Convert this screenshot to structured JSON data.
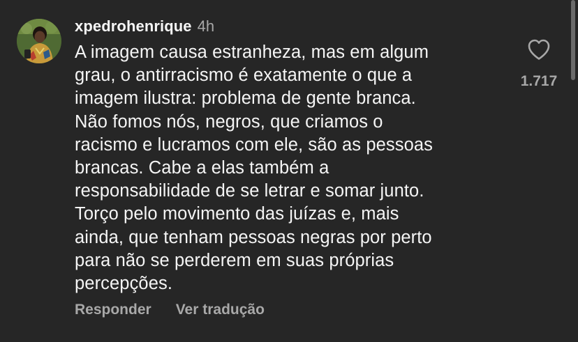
{
  "comment": {
    "username": "xpedrohenrique",
    "time": "4h",
    "text": "A imagem causa estranheza, mas em algum\ngrau, o antirracismo é exatamente o que a\nimagem ilustra: problema de gente branca.\nNão fomos nós, negros, que criamos o\nracismo e lucramos com ele, são as pessoas\nbrancas. Cabe a elas também a\nresponsabilidade de se letrar e somar junto.\nTorço pelo movimento das juízas e, mais\nainda, que tenham pessoas negras por perto\npara não se perderem em suas próprias\npercepções.",
    "like_count": "1.717",
    "actions": {
      "reply": "Responder",
      "translate": "Ver tradução"
    }
  },
  "icons": {
    "like": "heart-outline-icon",
    "avatar": "profile-photo"
  },
  "colors": {
    "background": "#262626",
    "primary_text": "#f5f5f5",
    "secondary_text": "#a8a8a8"
  }
}
